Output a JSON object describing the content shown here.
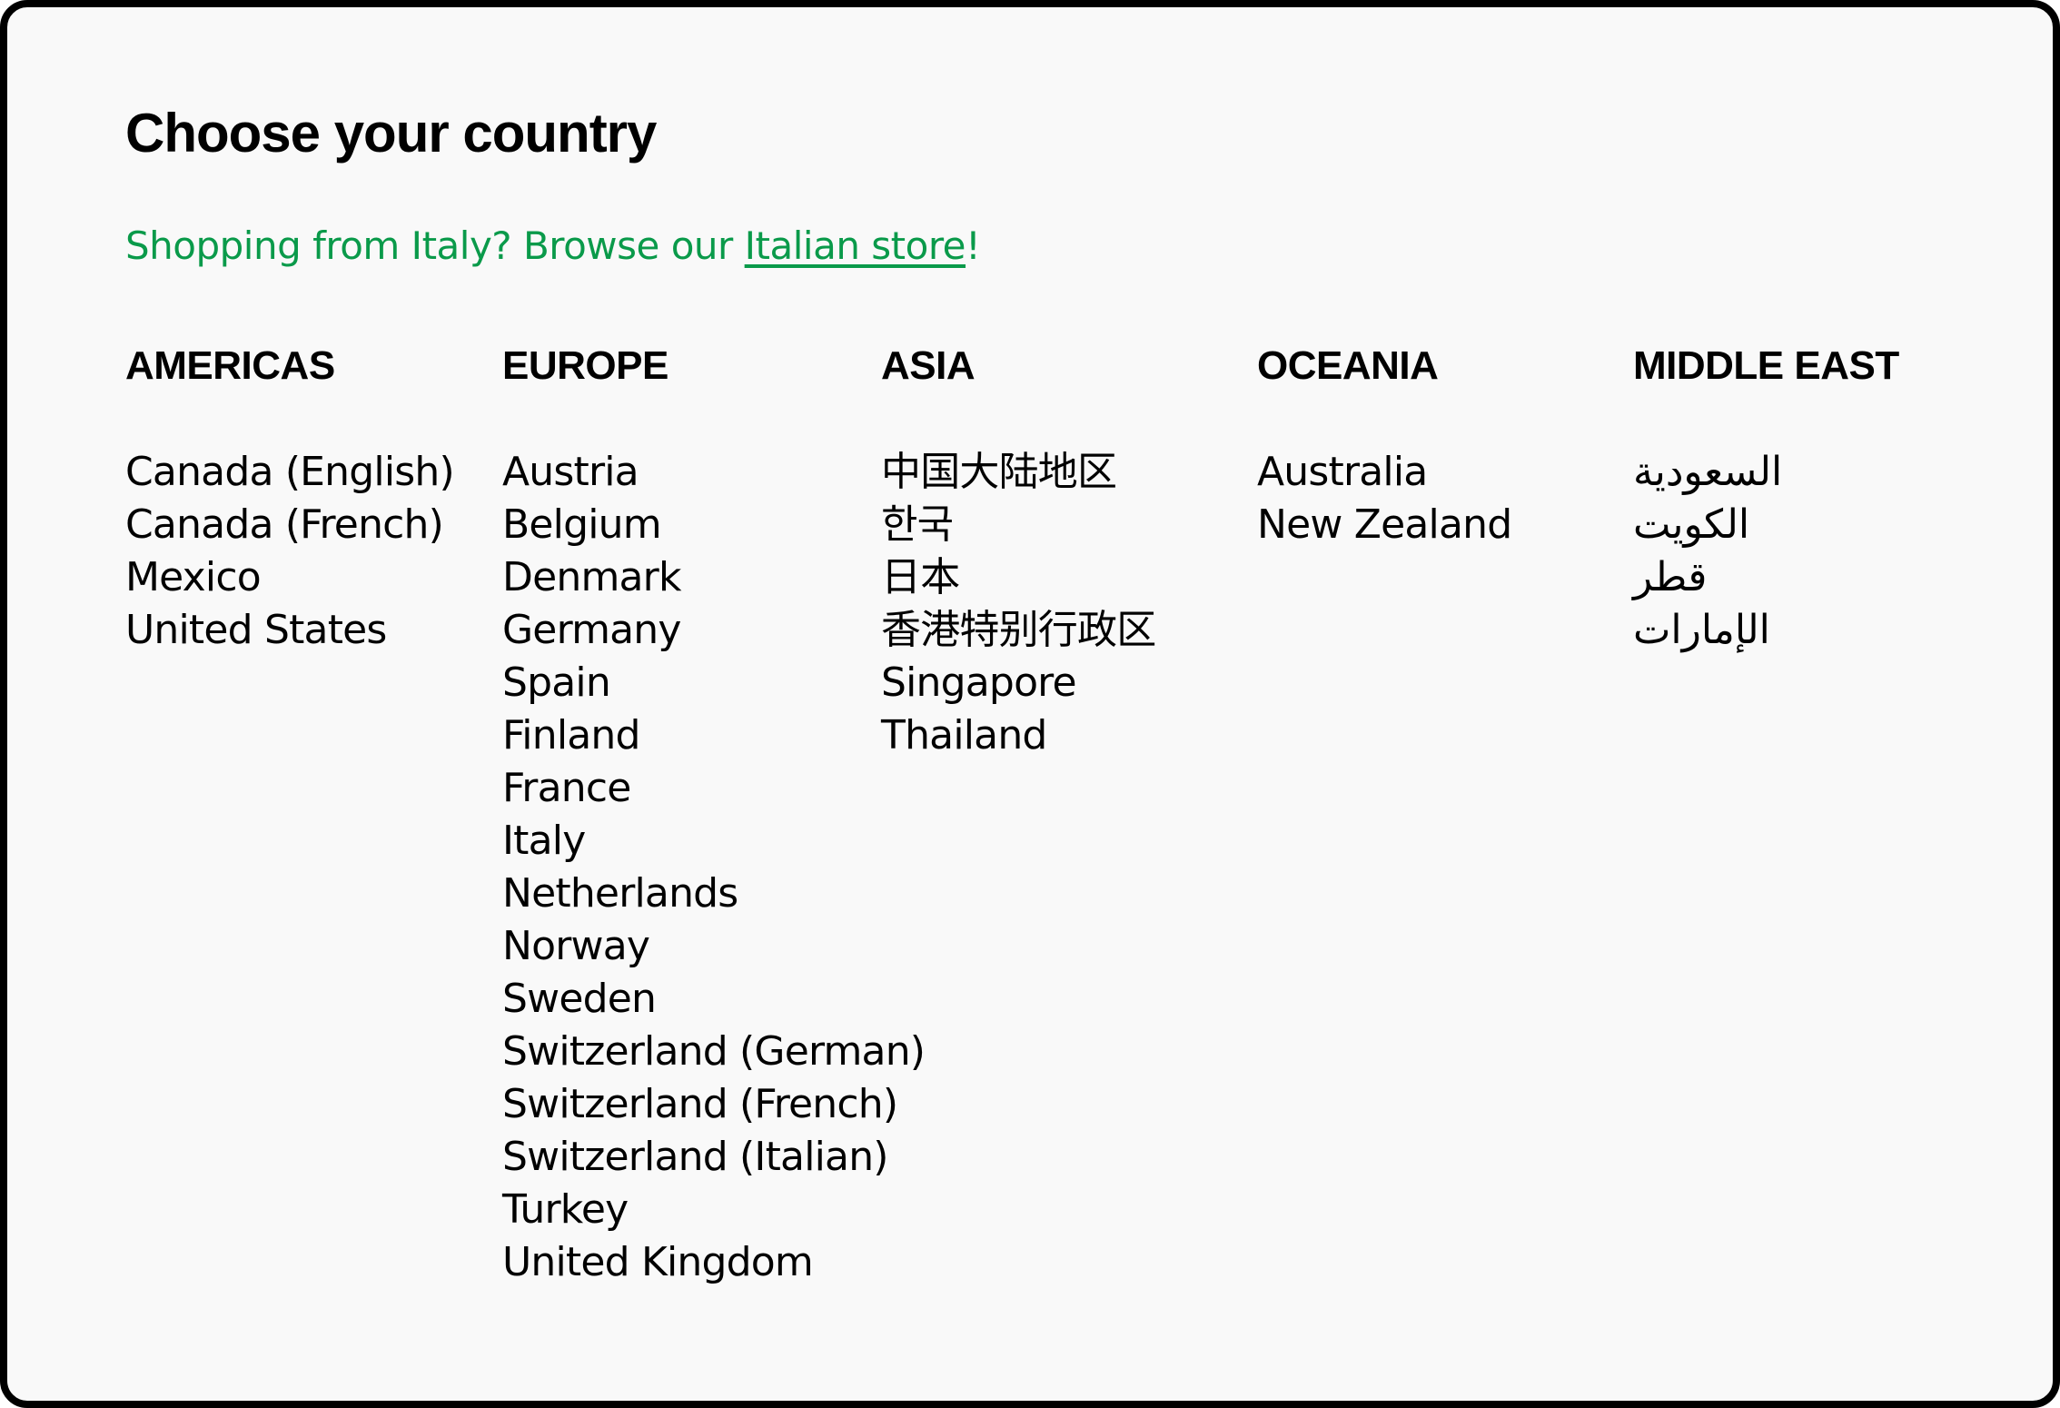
{
  "page": {
    "title": "Choose your country",
    "notice": {
      "prefix": "Shopping from Italy? Browse our ",
      "link_label": "Italian store",
      "suffix": "!",
      "color": "#0a9a4a"
    }
  },
  "regions": [
    {
      "name": "AMERICAS",
      "countries": [
        "Canada (English)",
        "Canada (French)",
        "Mexico",
        "United States"
      ]
    },
    {
      "name": "EUROPE",
      "countries": [
        "Austria",
        "Belgium",
        "Denmark",
        "Germany",
        "Spain",
        "Finland",
        "France",
        "Italy",
        "Netherlands",
        "Norway",
        "Sweden",
        "Switzerland (German)",
        "Switzerland (French)",
        "Switzerland (Italian)",
        "Turkey",
        "United Kingdom"
      ]
    },
    {
      "name": "ASIA",
      "countries": [
        "中国大陆地区",
        "한국",
        "日本",
        "香港特别行政区",
        "Singapore",
        "Thailand"
      ]
    },
    {
      "name": "OCEANIA",
      "countries": [
        "Australia",
        "New Zealand"
      ]
    },
    {
      "name": "MIDDLE EAST",
      "countries": [
        "السعودية",
        "الكويت",
        "قطر",
        "الإمارات"
      ]
    }
  ]
}
